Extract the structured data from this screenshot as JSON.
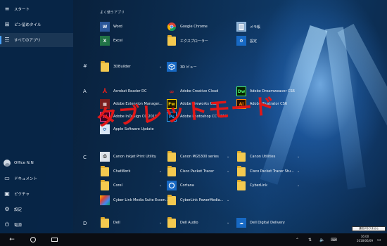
{
  "nav": {
    "top": [
      {
        "label": "スタート",
        "icon": "hamburger-icon"
      },
      {
        "label": "ピン留めタイル",
        "icon": "grid-icon"
      },
      {
        "label": "すべてのアプリ",
        "icon": "list-icon",
        "active": true
      }
    ],
    "bottom": [
      {
        "label": "Office N.N",
        "icon": "user-avatar-icon"
      },
      {
        "label": "ドキュメント",
        "icon": "document-icon"
      },
      {
        "label": "ピクチャ",
        "icon": "picture-icon"
      },
      {
        "label": "設定",
        "icon": "gear-icon"
      },
      {
        "label": "電源",
        "icon": "power-icon"
      }
    ]
  },
  "frequent": {
    "header": "よく使うアプリ",
    "items": [
      {
        "label": "Word",
        "icon": "word-icon",
        "color": "#2b579a"
      },
      {
        "label": "Excel",
        "icon": "excel-icon",
        "color": "#217346"
      },
      {
        "label": "Google Chrome",
        "icon": "chrome-icon"
      },
      {
        "label": "エクスプローラー",
        "icon": "folder-icon"
      },
      {
        "label": "メモ帳",
        "icon": "notepad-icon"
      },
      {
        "label": "設定",
        "icon": "gear-icon"
      }
    ]
  },
  "sections": {
    "hash": "#",
    "a": "A",
    "c": "C",
    "d": "D"
  },
  "hash_items": [
    {
      "label": "3DBuilder",
      "icon": "folder-icon"
    },
    {
      "label": "3D ビュー",
      "icon": "cube-icon"
    }
  ],
  "a_items": [
    {
      "label": "Acrobat Reader DC",
      "icon": "acrobat-icon"
    },
    {
      "label": "Adobe Creative Cloud",
      "icon": "creative-cloud-icon"
    },
    {
      "label": "Adobe Dreamweaver CS6",
      "icon": "dreamweaver-icon"
    },
    {
      "label": "Adobe Extension Manager...",
      "icon": "extension-icon"
    },
    {
      "label": "Adobe Fireworks CS6",
      "icon": "fireworks-icon"
    },
    {
      "label": "Adobe Illustrator CS6",
      "icon": "illustrator-icon"
    },
    {
      "label": "Adobe InDesign CC 2018",
      "icon": "indesign-icon"
    },
    {
      "label": "Adobe Photoshop CC 2018",
      "icon": "photoshop-icon"
    },
    {
      "label": "Apple Software Update",
      "icon": "apple-update-icon"
    }
  ],
  "c_items": [
    {
      "label": "Canon Inkjet Print Utility",
      "icon": "printer-icon"
    },
    {
      "label": "Canon MG5300 series",
      "icon": "folder-icon"
    },
    {
      "label": "Canon Utilities",
      "icon": "folder-icon"
    },
    {
      "label": "ChatWork",
      "icon": "folder-icon"
    },
    {
      "label": "Cisco Packet Tracer",
      "icon": "folder-icon"
    },
    {
      "label": "Cisco Packet Tracer Stu...",
      "icon": "folder-icon"
    },
    {
      "label": "Corel",
      "icon": "folder-icon"
    },
    {
      "label": "Cortana",
      "icon": "cortana-icon"
    },
    {
      "label": "CyberLink",
      "icon": "folder-icon"
    },
    {
      "label": "Cyber Link Media Suite Essen...",
      "icon": "cyberlink-icon"
    },
    {
      "label": "CyberLink PowerMedia...",
      "icon": "folder-icon"
    }
  ],
  "d_items": [
    {
      "label": "Dell",
      "icon": "folder-icon"
    },
    {
      "label": "Dell Audio",
      "icon": "folder-icon"
    },
    {
      "label": "Dell Digital Delivery",
      "icon": "cloud-icon"
    }
  ],
  "overlay": "タブレットモード",
  "taskbar": {
    "clock_time": "16:00",
    "clock_date": "2018/06/09",
    "notify_tip": "通知がありません"
  }
}
